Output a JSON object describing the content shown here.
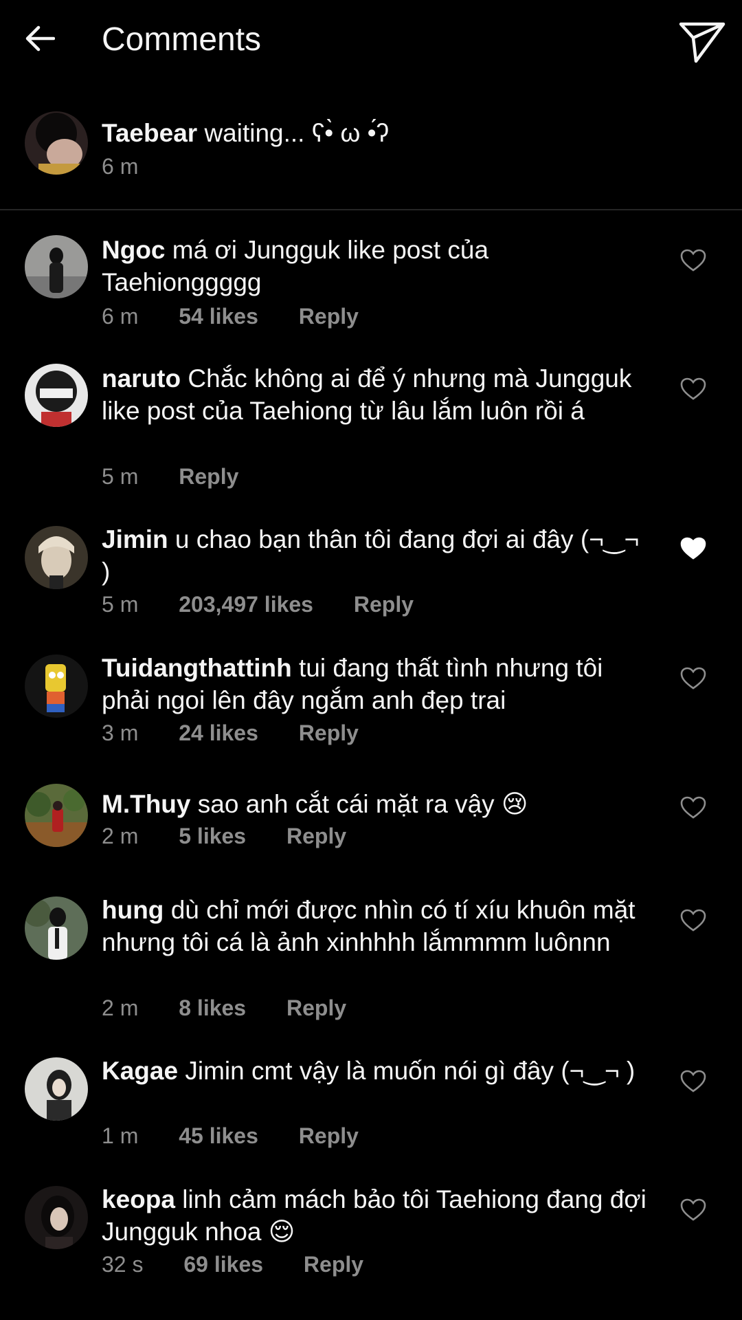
{
  "header": {
    "title": "Comments",
    "back_icon": "arrow-left-icon",
    "share_icon": "paper-plane-icon"
  },
  "caption": {
    "username": "Taebear",
    "text": "waiting... ʕ•̀ ω •́ʔ",
    "time": "6 m"
  },
  "comments": [
    {
      "username": "Ngoc",
      "text": "má ơi Jungguk like post của Taehionggggg",
      "time": "6 m",
      "likes": "54 likes",
      "reply": "Reply",
      "liked": false
    },
    {
      "username": "naruto",
      "text": "Chắc không ai để ý nhưng mà Jungguk like post của Taehiong từ lâu lắm luôn rồi á",
      "time": "5 m",
      "likes": "",
      "reply": "Reply",
      "liked": false
    },
    {
      "username": "Jimin",
      "text": "u chao bạn thân tôi đang đợi ai đây (¬‿¬ )",
      "time": "5 m",
      "likes": "203,497 likes",
      "reply": "Reply",
      "liked": true
    },
    {
      "username": "Tuidangthattinh",
      "text": "tui đang thất tình nhưng tôi phải ngoi lên đây ngắm anh đẹp trai",
      "time": "3 m",
      "likes": "24 likes",
      "reply": "Reply",
      "liked": false
    },
    {
      "username": "M.Thuy",
      "text": "sao anh cắt cái mặt ra vậy 😢",
      "time": "2 m",
      "likes": "5 likes",
      "reply": "Reply",
      "liked": false
    },
    {
      "username": "hung",
      "text": "dù chỉ mới được nhìn có tí xíu khuôn mặt nhưng tôi cá là ảnh xinhhhh lắmmmm luônnn",
      "time": "2 m",
      "likes": "8 likes",
      "reply": "Reply",
      "liked": false
    },
    {
      "username": "Kagae",
      "text": "Jimin cmt vậy là muốn nói gì đây (¬‿¬ )",
      "time": "1 m",
      "likes": "45 likes",
      "reply": "Reply",
      "liked": false
    },
    {
      "username": "keopa",
      "text": "linh cảm mách bảo tôi Taehiong đang đợi Jungguk nhoa 😌",
      "time": "32 s",
      "likes": "69 likes",
      "reply": "Reply",
      "liked": false
    }
  ],
  "colors": {
    "background": "#000000",
    "text": "#f5f5f5",
    "meta": "#8e8e8e",
    "divider": "#262626"
  }
}
